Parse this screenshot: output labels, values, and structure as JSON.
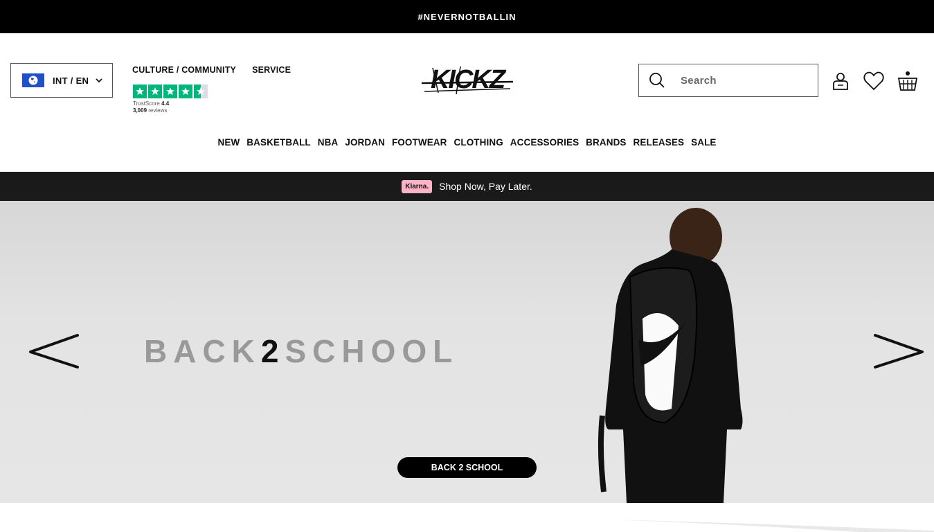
{
  "promo_bar": {
    "text": "#NEVERNOTBALLIN"
  },
  "locale": {
    "label": "INT / EN",
    "flag_icon": "globe-icon"
  },
  "top_links": [
    "CULTURE / COMMUNITY",
    "SERVICE"
  ],
  "trustpilot": {
    "score_label": "TrustScore",
    "score": "4.4",
    "reviews": "3,009",
    "reviews_label": "reviews",
    "rating": 4.4,
    "max": 5
  },
  "logo": {
    "text": "KICKZ"
  },
  "search": {
    "placeholder": "Search"
  },
  "header_icons": [
    "account-icon",
    "wishlist-heart-icon",
    "cart-basket-icon"
  ],
  "nav": [
    "NEW",
    "BASKETBALL",
    "NBA",
    "JORDAN",
    "FOOTWEAR",
    "CLOTHING",
    "ACCESSORIES",
    "BRANDS",
    "RELEASES",
    "SALE"
  ],
  "klarna": {
    "badge": "Klarna.",
    "text": "Shop Now, Pay Later."
  },
  "hero": {
    "title_left": "BACK",
    "title_num": "2",
    "title_right": "SCHOOL",
    "cta": "BACK 2 SCHOOL"
  },
  "colors": {
    "topbar": "#000000",
    "klarna_bar": "#1a1a1a",
    "klarna_pink": "#ffb3c7",
    "trustpilot_green": "#00b67a",
    "flag_blue": "#1f4fc9"
  }
}
